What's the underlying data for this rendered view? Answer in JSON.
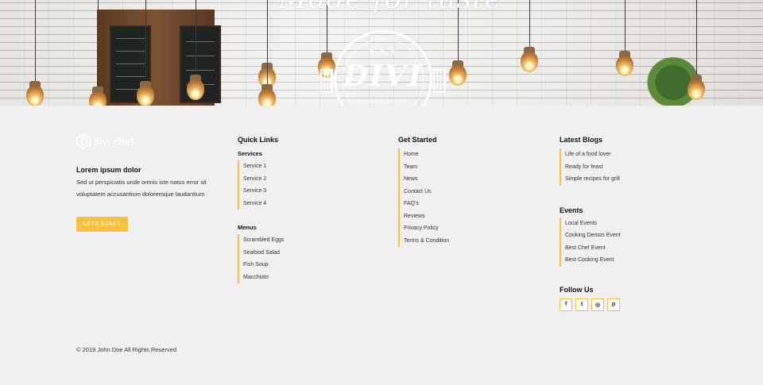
{
  "hero": {
    "script_text": "Made for taste",
    "badge": {
      "top_text": "EST 1990",
      "title": "DIVI",
      "subtitle": "Restaurant Template"
    }
  },
  "brand": {
    "logo_text": "divi chef"
  },
  "about": {
    "title": "Lorem ipsum dolor",
    "text": "Sed ut perspiciatis unde omnis iste natus error sit voluptatem accusantium doloremque laudantium",
    "cta_label": "LETS START"
  },
  "quick_links": {
    "heading": "Quick Links",
    "services": {
      "title": "Services",
      "items": [
        "Service 1",
        "Service 2",
        "Service 3",
        "Service 4"
      ]
    },
    "menus": {
      "title": "Menus",
      "items": [
        "Scrambled Eggs",
        "Seafood Salad",
        "Fish Soup",
        "Macchiato"
      ]
    }
  },
  "get_started": {
    "heading": "Get Started",
    "items": [
      "Home",
      "Team",
      "News",
      "Contact Us",
      "FAQ's",
      "Reviews",
      "Privacy Policy",
      "Terms & Condition"
    ]
  },
  "latest_blogs": {
    "heading": "Latest Blogs",
    "items": [
      "Life of a food lover",
      "Ready for feast",
      "Simple recipes for grill"
    ]
  },
  "events": {
    "heading": "Events",
    "items": [
      "Local Events",
      "Cooking Demos Event",
      "Best Chef Event",
      "Best Cooking Event"
    ]
  },
  "follow": {
    "heading": "Follow Us",
    "icons": [
      {
        "name": "facebook-icon",
        "glyph": "f"
      },
      {
        "name": "twitter-icon",
        "glyph": "t"
      },
      {
        "name": "instagram-icon",
        "glyph": "◎"
      },
      {
        "name": "pinterest-icon",
        "glyph": "p"
      }
    ]
  },
  "footer": {
    "copyright": "© 2019 John Doe All Rights Reserved"
  },
  "colors": {
    "accent": "#f6c143",
    "background": "#f1f0f0"
  }
}
